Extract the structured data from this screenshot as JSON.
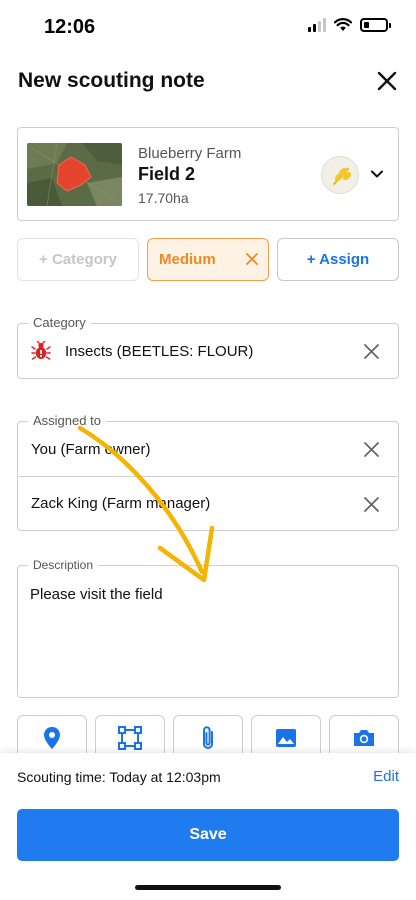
{
  "status_bar": {
    "time": "12:06",
    "battery_level": 0.25
  },
  "header": {
    "title": "New scouting note"
  },
  "field_card": {
    "farm": "Blueberry Farm",
    "field": "Field 2",
    "area": "17.70ha"
  },
  "chips": {
    "category": "+ Category",
    "priority": "Medium",
    "assign": "+ Assign"
  },
  "category_section": {
    "legend": "Category",
    "value": "Insects (BEETLES: FLOUR)"
  },
  "assigned_section": {
    "legend": "Assigned to",
    "people": [
      {
        "label": "You (Farm owner)"
      },
      {
        "label": "Zack King (Farm manager)"
      }
    ]
  },
  "description_section": {
    "legend": "Description",
    "value": "Please visit the field"
  },
  "toolbar": {
    "tools": [
      {
        "icon": "map-pin-icon"
      },
      {
        "icon": "draw-area-icon"
      },
      {
        "icon": "paperclip-icon"
      },
      {
        "icon": "image-icon"
      },
      {
        "icon": "camera-icon"
      }
    ]
  },
  "footer": {
    "scouting_time": "Scouting time: Today at 12:03pm",
    "edit_label": "Edit",
    "save_label": "Save"
  },
  "colors": {
    "accent_blue": "#1f7cf0",
    "priority_orange": "#ef8a22",
    "annotation_arrow": "#f5b400",
    "insect_red": "#e02020"
  }
}
